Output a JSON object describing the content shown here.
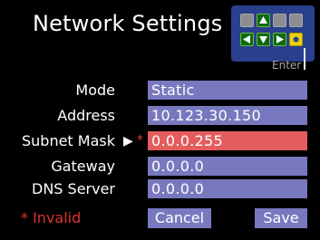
{
  "title": "Network Settings",
  "keypad": {
    "enter_label": "Enter",
    "keys": [
      {
        "name": "keypad-blank-key-1",
        "type": "blank",
        "icon": null
      },
      {
        "name": "keypad-up-key",
        "type": "func",
        "icon": "up-arrow"
      },
      {
        "name": "keypad-blank-key-2",
        "type": "blank",
        "icon": null
      },
      {
        "name": "keypad-blank-key-3",
        "type": "blank",
        "icon": null
      },
      {
        "name": "keypad-left-key",
        "type": "func",
        "icon": "left-arrow"
      },
      {
        "name": "keypad-down-key",
        "type": "func",
        "icon": "down-arrow"
      },
      {
        "name": "keypad-right-key",
        "type": "func",
        "icon": "right-arrow"
      },
      {
        "name": "keypad-enter-key",
        "type": "enter",
        "icon": "enter-circle"
      }
    ]
  },
  "form": {
    "fields": [
      {
        "label": "Mode",
        "value": "Static",
        "invalid": false
      },
      {
        "label": "Address",
        "value": "10.123.30.150",
        "invalid": false
      },
      {
        "label": "Subnet Mask",
        "value": "0.0.0.255",
        "invalid": true
      },
      {
        "label": "Gateway",
        "value": "0.0.0.0",
        "invalid": false
      },
      {
        "label": "DNS Server",
        "value": "0.0.0.0",
        "invalid": false
      }
    ],
    "selection_marker": "▶",
    "invalid_marker": "*"
  },
  "footer": {
    "invalid_note": "* Invalid",
    "cancel_label": "Cancel",
    "save_label": "Save"
  },
  "colors": {
    "background": "#000000",
    "field": "#7878bf",
    "invalid_field": "#e35d5d",
    "invalid_text": "#e03030",
    "keypad_panel": "#2a3f8e",
    "key_function": "#0e6a12",
    "key_blank": "#8d8d8d",
    "key_enter": "#e8d20e"
  }
}
